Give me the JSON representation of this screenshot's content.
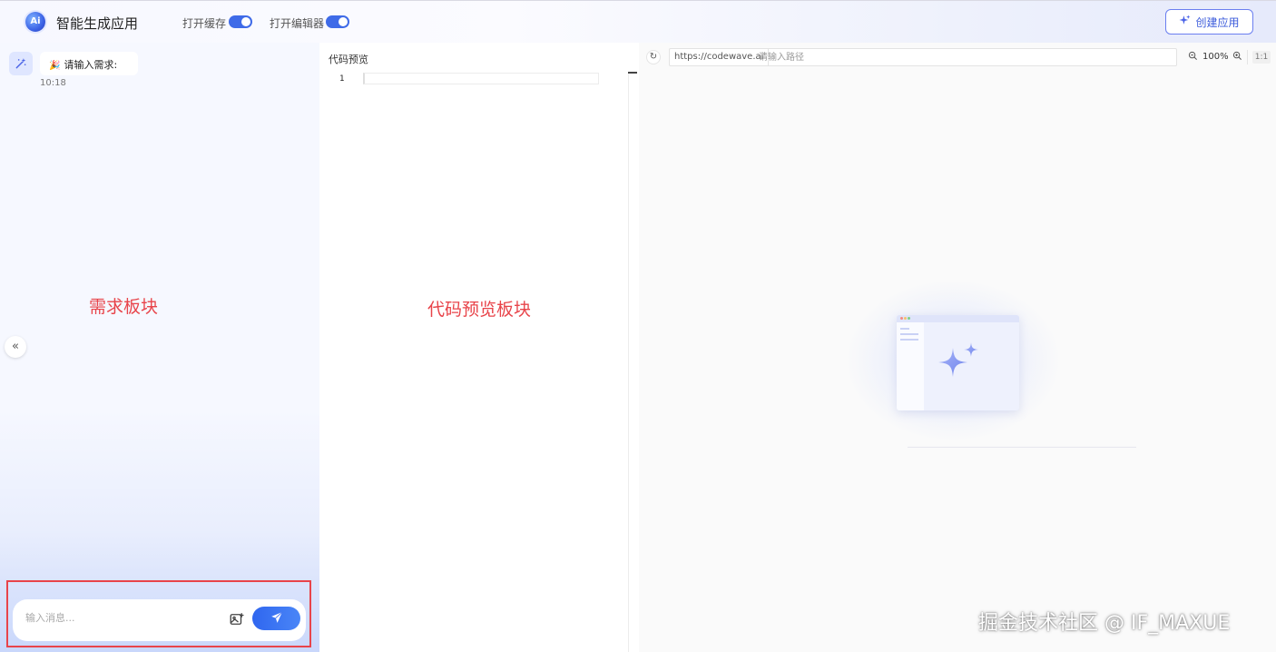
{
  "header": {
    "logo_text": "Ai",
    "title": "智能生成应用",
    "toggle_cache_label": "打开缓存",
    "toggle_editor_label": "打开编辑器",
    "create_button_label": "创建应用",
    "toggle_cache_on": true,
    "toggle_editor_on": true
  },
  "chat": {
    "message_text": "请输入需求:",
    "message_time": "10:18",
    "input_placeholder": "输入消息..."
  },
  "annotations": {
    "left_label": "需求板块",
    "middle_label": "代码预览板块"
  },
  "code_preview": {
    "title": "代码预览",
    "line_number": "1"
  },
  "preview": {
    "url_base": "https://codewave.ai",
    "path_placeholder": "请输入路径",
    "zoom_level": "100%",
    "ratio_label": "1:1"
  },
  "watermark": "掘金技术社区 @ IF_MAXUE",
  "colors": {
    "accent": "#3f6be8",
    "annotation": "#e8444a"
  },
  "icons": {
    "collapse": "double-chevron-left-icon",
    "send": "paper-plane-icon",
    "image": "image-add-icon",
    "refresh": "refresh-icon",
    "zoom_out": "zoom-out-icon",
    "zoom_in": "zoom-in-icon",
    "sparkle": "sparkle-icon"
  }
}
